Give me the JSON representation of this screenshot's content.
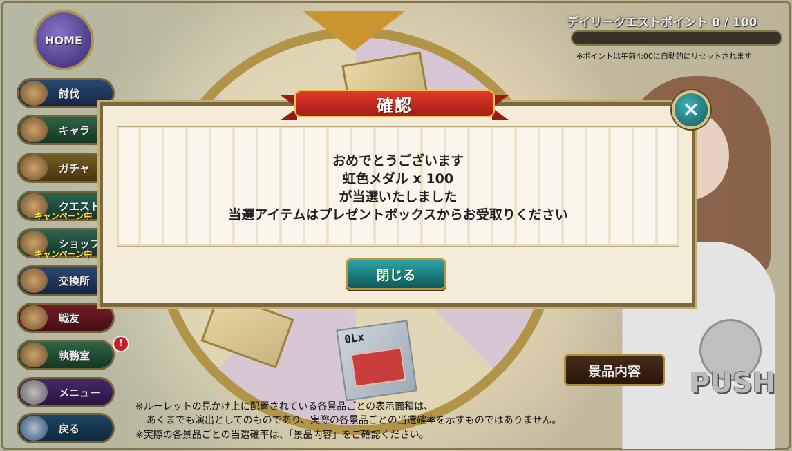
{
  "header": {
    "home_label": "HOME",
    "quest_title": "デイリークエストポイント 0 / 100",
    "quest_progress": 0,
    "quest_note": "※ポイントは午前4:00に自動的にリセットされます"
  },
  "sidebar": {
    "items": [
      {
        "label": "討伐",
        "sub": ""
      },
      {
        "label": "キャラ",
        "sub": ""
      },
      {
        "label": "ガチャ",
        "sub": ""
      },
      {
        "label": "クエスト",
        "sub": "キャンペーン中"
      },
      {
        "label": "ショップ",
        "sub": "キャンペーン中"
      },
      {
        "label": "交換所",
        "sub": ""
      },
      {
        "label": "戦友",
        "sub": ""
      },
      {
        "label": "執務室",
        "sub": ""
      },
      {
        "label": "メニュー",
        "sub": ""
      },
      {
        "label": "戻る",
        "sub": ""
      }
    ],
    "notification_badge": "!"
  },
  "roulette": {
    "ticket_count": "0Lx"
  },
  "buttons": {
    "prize_contents": "景品内容",
    "push": "PUSH"
  },
  "notes": {
    "line1": "※ルーレットの見かけ上に配置されている各景品ごとの表示面積は、",
    "line2": "あくまでも演出としてのものであり、実際の各景品ごとの当選確率を示すものではありません。",
    "line3": "※実際の各景品ごとの当選確率は、「景品内容」をご確認ください。"
  },
  "dialog": {
    "title": "確認",
    "close_icon": "×",
    "lines": [
      "おめでとうございます",
      "虹色メダル x 100",
      "が当選いたしました",
      "当選アイテムはプレゼントボックスからお受取りください"
    ],
    "close_button": "閉じる"
  }
}
